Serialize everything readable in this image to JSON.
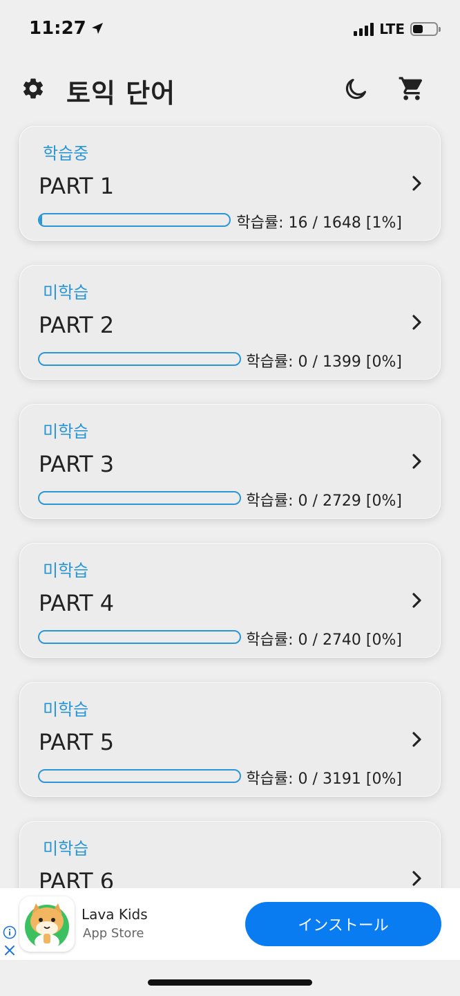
{
  "status_bar": {
    "time": "11:27",
    "network": "LTE",
    "battery_level": 0.45
  },
  "header": {
    "title": "토익 단어",
    "icons": [
      "gear-icon",
      "moon-icon",
      "cart-icon"
    ]
  },
  "parts": [
    {
      "status": "학습중",
      "title": "PART 1",
      "progress_text": "학습률: 16 / 1648 [1%]",
      "progress": 0.01
    },
    {
      "status": "미학습",
      "title": "PART 2",
      "progress_text": "학습률: 0 / 1399 [0%]",
      "progress": 0
    },
    {
      "status": "미학습",
      "title": "PART 3",
      "progress_text": "학습률: 0 / 2729 [0%]",
      "progress": 0
    },
    {
      "status": "미학습",
      "title": "PART 4",
      "progress_text": "학습률: 0 / 2740 [0%]",
      "progress": 0
    },
    {
      "status": "미학습",
      "title": "PART 5",
      "progress_text": "학습률: 0 / 3191 [0%]",
      "progress": 0
    },
    {
      "status": "미학습",
      "title": "PART 6",
      "progress_text": "",
      "progress": 0
    }
  ],
  "ad": {
    "app_name": "Lava Kids",
    "store": "App Store",
    "install_label": "インストール"
  },
  "colors": {
    "accent": "#2b96d6",
    "install": "#0a7cf1",
    "background": "#efefef"
  }
}
